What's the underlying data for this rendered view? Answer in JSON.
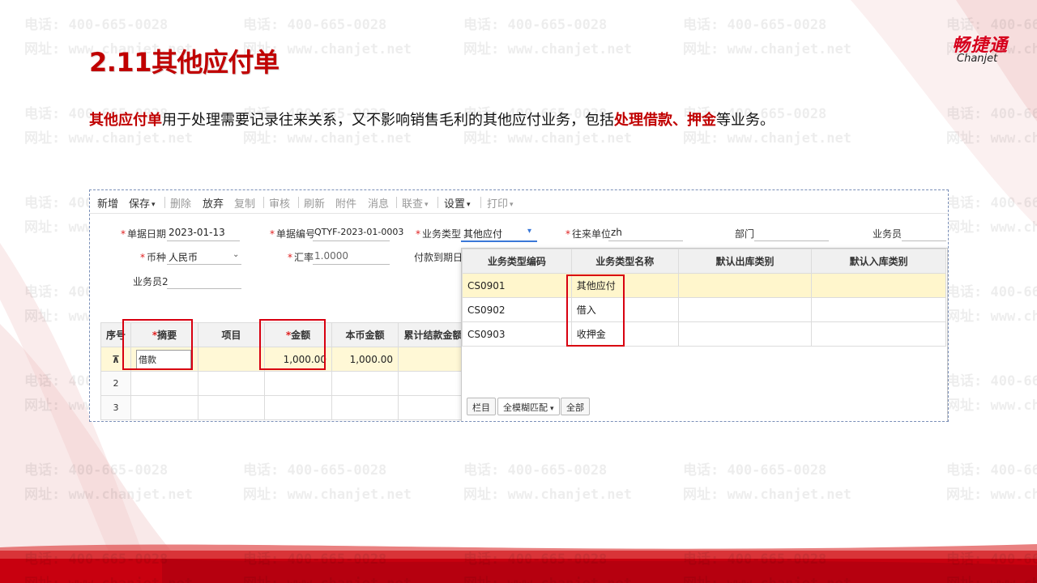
{
  "slide": {
    "title": "2.11其他应付单",
    "description": {
      "part1": "其他应付单",
      "part2": "用于处理需要记录往来关系，又不影响销售毛利的其他应付业务，包括",
      "part3": "处理借款、押金",
      "part4": "等业务。"
    }
  },
  "logo": {
    "cn": "畅捷通",
    "en": "Chanjet"
  },
  "watermark": {
    "phone": "电话: 400-665-0028",
    "site": "网址: www.chanjet.net"
  },
  "colors": {
    "accent": "#c00000",
    "highlight_box": "#d80010",
    "active_row": "#fff8d6"
  },
  "toolbar": [
    {
      "label": "新增",
      "enabled": true,
      "dropdown": false
    },
    {
      "label": "保存",
      "enabled": true,
      "dropdown": true
    },
    {
      "label": "删除",
      "enabled": false,
      "dropdown": false
    },
    {
      "label": "放弃",
      "enabled": true,
      "dropdown": false
    },
    {
      "label": "复制",
      "enabled": false,
      "dropdown": false
    },
    {
      "label": "审核",
      "enabled": false,
      "dropdown": false
    },
    {
      "label": "刷新",
      "enabled": false,
      "dropdown": false
    },
    {
      "label": "附件",
      "enabled": false,
      "dropdown": false
    },
    {
      "label": "消息",
      "enabled": false,
      "dropdown": false
    },
    {
      "label": "联查",
      "enabled": false,
      "dropdown": true
    },
    {
      "label": "设置",
      "enabled": true,
      "dropdown": true
    },
    {
      "label": "打印",
      "enabled": false,
      "dropdown": true
    }
  ],
  "form": {
    "doc_date_label": "单据日期",
    "doc_date": "2023-01-13",
    "doc_no_label": "单据编号",
    "doc_no": "QTYF-2023-01-0003",
    "biz_type_label": "业务类型",
    "biz_type": "其他应付",
    "partner_label": "往来单位",
    "partner": "zh",
    "dept_label": "部门",
    "salesman_label": "业务员",
    "currency_label": "币种",
    "currency": "人民币",
    "rate_label": "汇率",
    "rate": "1.0000",
    "due_label": "付款到期日",
    "salesman2_label": "业务员2"
  },
  "grid": {
    "headers": [
      "序号",
      "摘要",
      "项目",
      "金额",
      "本币金额",
      "累计结款金额"
    ],
    "rows": [
      {
        "seq": "",
        "summary": "借款",
        "project": "",
        "amount": "1,000.00",
        "base_amount": "1,000.00",
        "settled": ""
      },
      {
        "seq": "2",
        "summary": "",
        "project": "",
        "amount": "",
        "base_amount": "",
        "settled": ""
      },
      {
        "seq": "3",
        "summary": "",
        "project": "",
        "amount": "",
        "base_amount": "",
        "settled": ""
      }
    ]
  },
  "popup": {
    "headers": [
      "业务类型编码",
      "业务类型名称",
      "默认出库类别",
      "默认入库类别"
    ],
    "rows": [
      {
        "code": "CS0901",
        "name": "其他应付",
        "out": "",
        "in": ""
      },
      {
        "code": "CS0902",
        "name": "借入",
        "out": "",
        "in": ""
      },
      {
        "code": "CS0903",
        "name": "收押金",
        "out": "",
        "in": ""
      }
    ],
    "btn_columns": "栏目",
    "match_mode": "全模糊匹配",
    "btn_all": "全部"
  }
}
